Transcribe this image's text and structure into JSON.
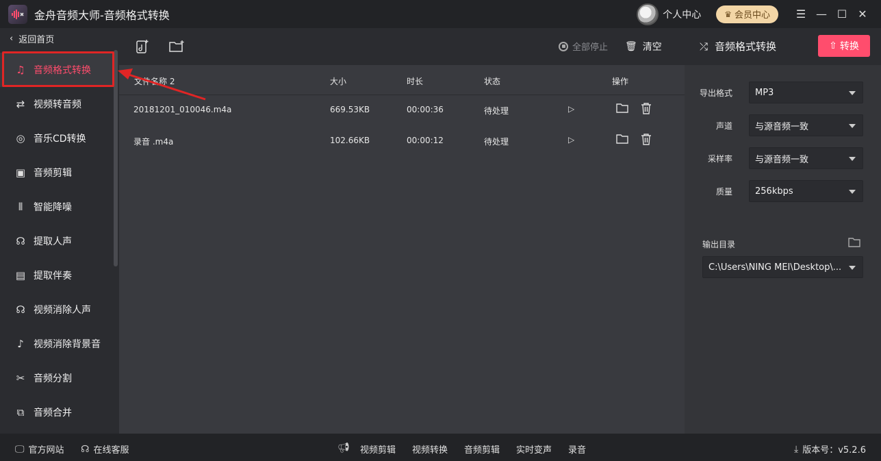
{
  "app": {
    "title": "金舟音频大师-音频格式转换"
  },
  "titlebar": {
    "personal_center": "个人中心",
    "vip_center": "会员中心",
    "icons": [
      "menu-icon",
      "minimize-icon",
      "maximize-icon",
      "close-icon"
    ]
  },
  "sidebar": {
    "back_label": "返回首页",
    "items": [
      {
        "label": "音频格式转换",
        "icon": "audio-convert-icon",
        "active": true
      },
      {
        "label": "视频转音频",
        "icon": "video-to-audio-icon"
      },
      {
        "label": "音乐CD转换",
        "icon": "cd-icon"
      },
      {
        "label": "音频剪辑",
        "icon": "audio-cut-icon"
      },
      {
        "label": "智能降噪",
        "icon": "denoise-icon"
      },
      {
        "label": "提取人声",
        "icon": "voice-extract-icon"
      },
      {
        "label": "提取伴奏",
        "icon": "accompaniment-icon"
      },
      {
        "label": "视频消除人声",
        "icon": "video-remove-voice-icon"
      },
      {
        "label": "视频消除背景音",
        "icon": "video-remove-bg-icon"
      },
      {
        "label": "音频分割",
        "icon": "audio-split-icon"
      },
      {
        "label": "音频合并",
        "icon": "audio-merge-icon"
      }
    ]
  },
  "toolbar": {
    "stop_all": "全部停止",
    "clear": "清空"
  },
  "table": {
    "headers": {
      "name": "文件名称 2",
      "size": "大小",
      "duration": "时长",
      "status": "状态",
      "action": "操作"
    },
    "rows": [
      {
        "name": "20181201_010046.m4a",
        "size": "669.53KB",
        "duration": "00:00:36",
        "status": "待处理"
      },
      {
        "name": "录音 .m4a",
        "size": "102.66KB",
        "duration": "00:00:12",
        "status": "待处理"
      }
    ]
  },
  "right_panel": {
    "title": "音频格式转换",
    "convert_button": "转换",
    "settings": [
      {
        "label": "导出格式",
        "value": "MP3"
      },
      {
        "label": "声道",
        "value": "与源音频一致"
      },
      {
        "label": "采样率",
        "value": "与源音频一致"
      },
      {
        "label": "质量",
        "value": "256kbps"
      }
    ],
    "output_label": "输出目录",
    "output_path": "C:\\Users\\NING MEI\\Desktop\\..."
  },
  "footer": {
    "website": "官方网站",
    "service": "在线客服",
    "links": [
      "视频剪辑",
      "视频转换",
      "音频剪辑",
      "实时变声",
      "录音"
    ],
    "version": "版本号：v5.2.6"
  },
  "colors": {
    "accent": "#ff4d6d",
    "annotation": "#e02525",
    "vip": "#f3d6a6"
  }
}
